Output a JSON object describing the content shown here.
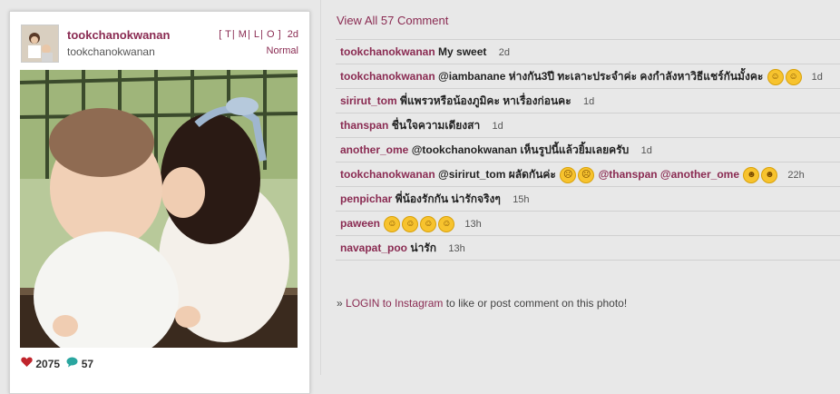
{
  "post": {
    "username": "tookchanokwanan",
    "fullname": "tookchanokwanan",
    "links": [
      "T",
      "M",
      "L",
      "O"
    ],
    "time": "2d",
    "filter": "Normal",
    "likes": "2075",
    "comment_count": "57"
  },
  "comments_panel": {
    "view_all": "View All 57 Comment",
    "login_link": "LOGIN to Instagram",
    "login_rest": " to like or post comment on this photo!",
    "login_prefix": "»"
  },
  "comments": [
    {
      "author": "tookchanokwanan",
      "text": "My sweet",
      "time": "2d"
    },
    {
      "author": "tookchanokwanan",
      "text": "@iambanane ห่างกัน3ปี ทะเลาะประจำค่ะ คงกำลังหาวิธีแชร์กันมั้งคะ",
      "emoji": [
        "smile",
        "smile"
      ],
      "time": "1d"
    },
    {
      "author": "sirirut_tom",
      "text": "พี่แพรวหรือน้องภูมิคะ หาเรื่องก่อนคะ",
      "time": "1d"
    },
    {
      "author": "thanspan",
      "text": "ชื่นใจความเดียงสา",
      "time": "1d"
    },
    {
      "author": "another_ome",
      "text": "@tookchanokwanan เห็นรูปนี้แล้วยิ้มเลยครับ",
      "time": "1d"
    },
    {
      "author": "tookchanokwanan",
      "text": "@sirirut_tom ผลัดกันค่ะ",
      "emoji": [
        "frown",
        "frown"
      ],
      "text2": "@thanspan @another_ome",
      "emoji2": [
        "grin",
        "grin"
      ],
      "time": "22h"
    },
    {
      "author": "penpichar",
      "text": "พี่น้องรักกัน น่ารักจริงๆ",
      "time": "15h"
    },
    {
      "author": "paween",
      "text": "",
      "emoji": [
        "smile",
        "smile",
        "smile",
        "smile"
      ],
      "time": "13h"
    },
    {
      "author": "navapat_poo",
      "text": "น่ารัก",
      "time": "13h"
    }
  ],
  "icons": {
    "like": "heart-icon",
    "comment": "speech-bubble-icon",
    "emoji_color": "#f7c32e"
  }
}
